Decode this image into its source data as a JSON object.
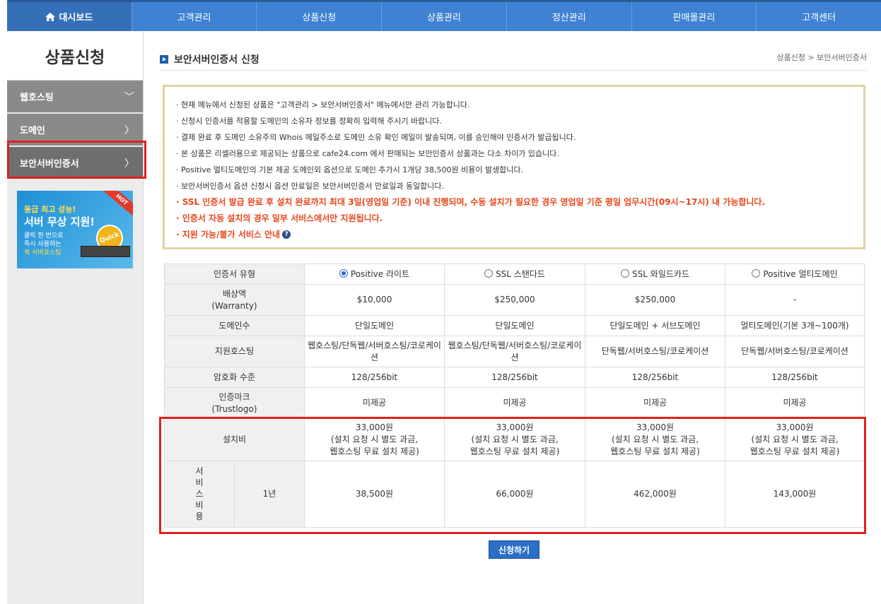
{
  "topnav": {
    "items": [
      "대시보드",
      "고객관리",
      "상품신청",
      "상품관리",
      "정산관리",
      "판매몰관리",
      "고객센터"
    ]
  },
  "sidebar": {
    "title": "상품신청",
    "items": [
      {
        "label": "웹호스팅",
        "chevron": "﹀"
      },
      {
        "label": "도메인",
        "chevron": "〉"
      },
      {
        "label": "보안서버인증서",
        "chevron": "〉"
      }
    ],
    "banner": {
      "line1": "동급 최고 성능!",
      "line2": "서버 무상 지원!",
      "line3": "클릭 한 번으로",
      "line4": "즉시 사용하는",
      "line5": "퀵 서버호스팅",
      "hot": "HOT",
      "badge": "Quick"
    }
  },
  "page": {
    "title": "보안서버인증서 신청",
    "breadcrumb": "상품신청 > 보안서버인증서"
  },
  "notice": {
    "lines": [
      "· 현재 메뉴에서 신청된 상품은 \"고객관리 > 보안서버인증서\" 메뉴에서만 관리 가능합니다.",
      "· 신청시 인증서를 적용할 도메인의 소유자 정보를 정확히 입력해 주시기 바랍니다.",
      "· 결제 완료 후 도메인 소유주의 Whois 메일주소로 도메인 소유 확인 메일이 발송되며, 이를 승인해야 인증서가 발급됩니다.",
      "· 본 상품은 리셀러용으로 제공되는 상품으로 cafe24.com 에서 판매되는 보안인증서 상품과는 다소 차이가 있습니다.",
      "· Positive 멀티도메인의 기본 제공 도메인외 옵션으로 도메인 추가시 1개당 38,500원 비용이 발생합니다.",
      "· 보안서버인증서 옵션 신청시 옵션 만료일은 보안서버인증서 만료일과 동일합니다."
    ],
    "red_lines": [
      "· SSL 인증서 발급 완료 후 설치 완료까지 최대 3일(영업일 기준) 이내 진행되며, 수동 설치가 필요한 경우 영업일 기준 평일 업무시간(09시~17시) 내 가능합니다.",
      "· 인증서 자동 설치의 경우 일부 서비스에서만 지원됩니다.",
      "· 지원 가능/불가 서비스 안내"
    ],
    "help_icon": "?"
  },
  "table": {
    "label_cert_type": "인증서 유형",
    "products": [
      "Positive 라이트",
      "SSL 스탠다드",
      "SSL 와일드카드",
      "Positive 멀티도메인"
    ],
    "label_warranty": "배상액\n(Warranty)",
    "warranty": [
      "$10,000",
      "$250,000",
      "$250,000",
      "-"
    ],
    "label_domains": "도메인수",
    "domains": [
      "단일도메인",
      "단일도메인",
      "단일도메인 + 서브도메인",
      "멀티도메인(기본 3개~100개)"
    ],
    "label_hosting": "지원호스팅",
    "hosting": [
      "웹호스팅/단독웹/서버호스팅/코로케이션",
      "웹호스팅/단독웹/서버호스팅/코로케이션",
      "단독웹/서버호스팅/코로케이션",
      "단독웹/서버호스팅/코로케이션"
    ],
    "label_encryption": "암호화 수준",
    "encryption": [
      "128/256bit",
      "128/256bit",
      "128/256bit",
      "128/256bit"
    ],
    "label_trustlogo": "인증마크\n(Trustlogo)",
    "trustlogo": [
      "미제공",
      "미제공",
      "미제공",
      "미제공"
    ],
    "label_install": "설치비",
    "install": [
      "33,000원\n(설치 요청 시 별도 과금,\n웹호스팅 무료 설치 제공)",
      "33,000원\n(설치 요청 시 별도 과금,\n웹호스팅 무료 설치 제공)",
      "33,000원\n(설치 요청 시 별도 과금,\n웹호스팅 무료 설치 제공)",
      "33,000원\n(설치 요청 시 별도 과금,\n웹호스팅 무료 설치 제공)"
    ],
    "label_service_fee": "서비스비용",
    "period": "1년",
    "fees": [
      "38,500원",
      "66,000원",
      "462,000원",
      "143,000원"
    ],
    "selected_index": 0
  },
  "apply_button": "신청하기",
  "colors": {
    "nav": "#3f82d4",
    "highlight": "#e02020",
    "notice_red": "#e8461a",
    "button": "#2b6fc7"
  }
}
